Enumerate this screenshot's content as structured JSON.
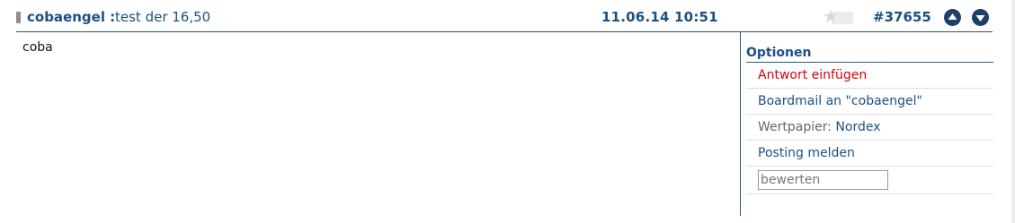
{
  "post": {
    "author": "cobaengel :",
    "subject": "test der 16,50",
    "datetime": "11.06.14 10:51",
    "id": "#37655",
    "body": "coba"
  },
  "icons": {
    "star": "star-icon",
    "up": "arrow-up-circle-icon",
    "down": "arrow-down-circle-icon"
  },
  "options": {
    "title": "Optionen",
    "reply": "Antwort einfügen",
    "boardmail": "Boardmail an \"cobaengel\"",
    "security_label": "Wertpapier:",
    "security_value": "Nordex",
    "report": "Posting melden",
    "rate_placeholder": "bewerten"
  },
  "colors": {
    "brand": "#1b4f86",
    "accent_red": "#d8000c",
    "button_dark": "#1f3f66"
  }
}
